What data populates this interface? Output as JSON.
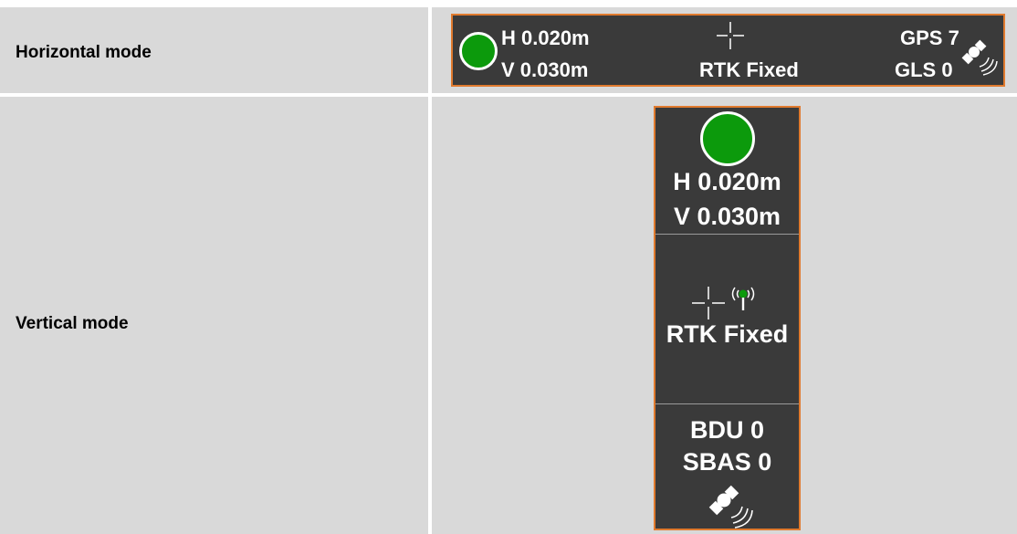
{
  "rows": {
    "horizontal_label": "Horizontal mode",
    "vertical_label": "Vertical mode"
  },
  "horizontal": {
    "h_precision": "H 0.020m",
    "v_precision": "V 0.030m",
    "solution": "RTK Fixed",
    "gps": "GPS 7",
    "gls": "GLS 0"
  },
  "vertical": {
    "h_precision": "H 0.020m",
    "v_precision": "V 0.030m",
    "solution": "RTK Fixed",
    "bdu": "BDU 0",
    "sbas": "SBAS 0"
  },
  "colors": {
    "panel_bg": "#3a3a3a",
    "panel_border": "#e07a2e",
    "fix_status": "#0c9a0c",
    "table_cell": "#d9d9d9"
  },
  "icons": [
    "status-dot-icon",
    "crosshair-icon",
    "radio-antenna-icon",
    "satellite-icon"
  ]
}
